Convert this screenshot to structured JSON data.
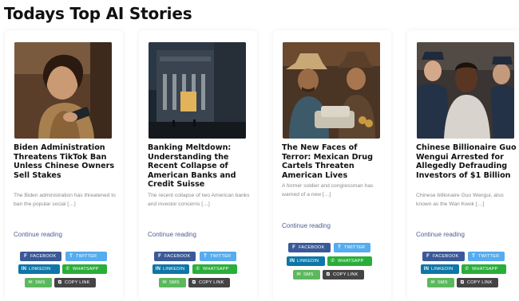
{
  "page": {
    "title": "Todays Top AI Stories"
  },
  "cards": [
    {
      "title": "Biden Administration Threatens TikTok Ban Unless Chinese Owners Sell Stakes",
      "excerpt": "The Biden administration has threatened to ban the popular social […]",
      "read_more": "Continue reading",
      "image": "teen-using-phone"
    },
    {
      "title": "Banking Meltdown: Understanding the Recent Collapse of American Banks and Credit Suisse",
      "excerpt": "The recent collapse of two American banks and investor concerns […]",
      "read_more": "Continue reading",
      "image": "bank-building-at-night"
    },
    {
      "title": "The New Faces of Terror: Mexican Drug Cartels Threaten American Lives",
      "excerpt": "A former soldier and congressman has warned of a new […]",
      "read_more": "Continue reading",
      "image": "cowboys-with-packages"
    },
    {
      "title": "Chinese Billionaire Guo Wengui Arrested for Allegedly Defrauding Investors of $1 Billion",
      "excerpt": "Chinese billionaire Guo Wengui, also known as the Wan Kwok […]",
      "read_more": "Continue reading",
      "image": "man-arrested-by-police"
    }
  ],
  "share": {
    "facebook": "Facebook",
    "twitter": "Twitter",
    "linkedin": "LinkedIn",
    "whatsapp": "WhatsApp",
    "sms": "SMS",
    "copy_link": "Copy Link"
  },
  "colors": {
    "facebook": "#3b5998",
    "twitter": "#55acee",
    "linkedin": "#0e76a8",
    "whatsapp": "#2aae3a",
    "sms": "#5cb85c",
    "copy_link": "#444444",
    "link": "#4a5f8c"
  }
}
